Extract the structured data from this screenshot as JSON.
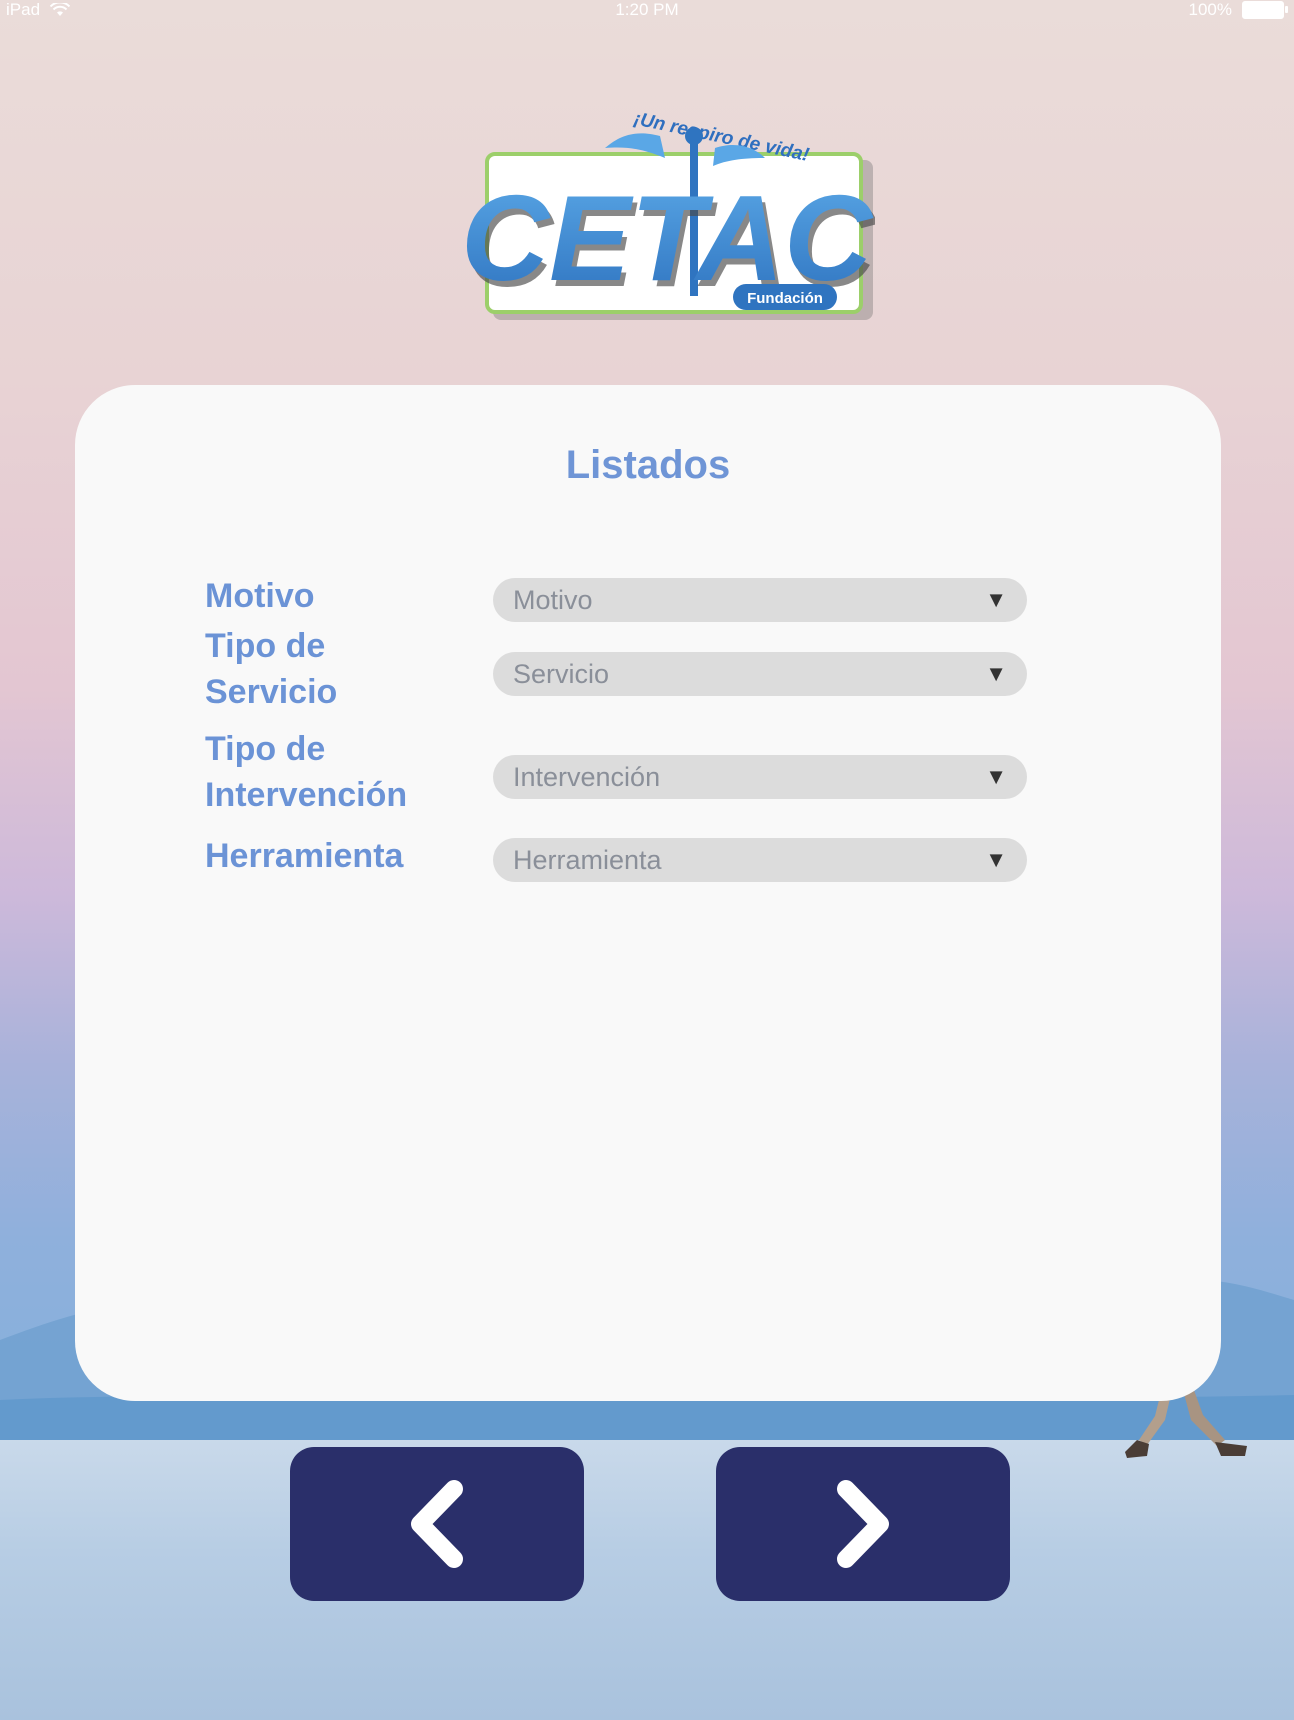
{
  "status_bar": {
    "device": "iPad",
    "time": "1:20 PM",
    "battery": "100%"
  },
  "logo": {
    "name": "CETAC",
    "tagline": "¡Un respiro de vida!",
    "subtitle": "Fundación"
  },
  "card": {
    "title": "Listados"
  },
  "form": {
    "fields": [
      {
        "label_lines": [
          "Motivo"
        ],
        "value": "Motivo"
      },
      {
        "label_lines": [
          "Tipo de",
          "Servicio"
        ],
        "value": "Servicio"
      },
      {
        "label_lines": [
          "Tipo de",
          "Intervención"
        ],
        "value": "Intervención"
      },
      {
        "label_lines": [
          "Herramienta"
        ],
        "value": "Herramienta"
      }
    ]
  },
  "nav": {
    "back_icon": "chevron-left-icon",
    "next_icon": "chevron-right-icon"
  },
  "colors": {
    "accent": "#6b93d6",
    "button": "#2a2f6a",
    "select_bg": "#dcdcdc"
  }
}
